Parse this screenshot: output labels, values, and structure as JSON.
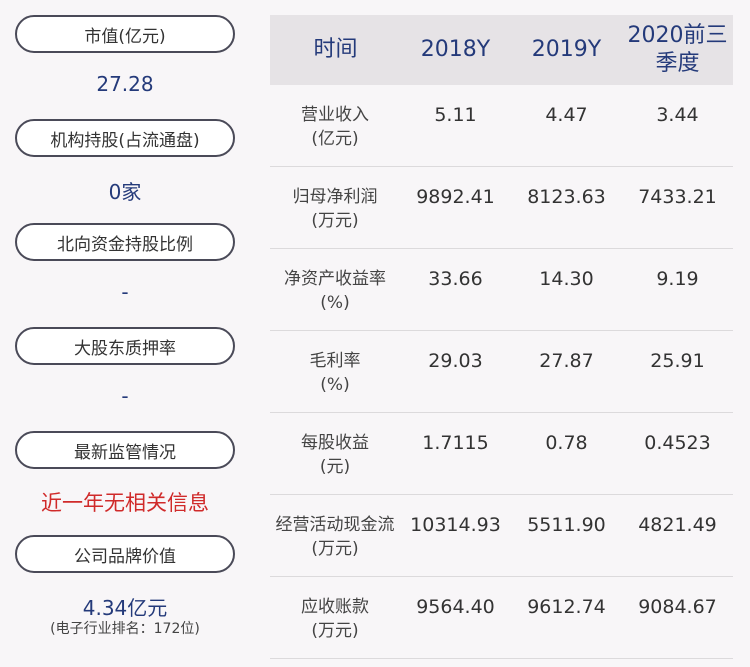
{
  "left": {
    "items": [
      {
        "label": "市值(亿元)",
        "value": "27.28"
      },
      {
        "label": "机构持股(占流通盘)",
        "value": "0家"
      },
      {
        "label": "北向资金持股比例",
        "value": "-"
      },
      {
        "label": "大股东质押率",
        "value": "-"
      },
      {
        "label": "最新监管情况",
        "value": "近一年无相关信息"
      },
      {
        "label": "公司品牌价值",
        "value": "4.34亿元",
        "sub": "(电子行业排名：172位)"
      }
    ]
  },
  "table": {
    "headers": [
      "时间",
      "2018Y",
      "2019Y",
      "2020前三季度"
    ],
    "rows": [
      {
        "label1": "营业收入",
        "label2": "(亿元)",
        "values": [
          "5.11",
          "4.47",
          "3.44"
        ]
      },
      {
        "label1": "归母净利润",
        "label2": "(万元)",
        "values": [
          "9892.41",
          "8123.63",
          "7433.21"
        ]
      },
      {
        "label1": "净资产收益率",
        "label2": "(%)",
        "values": [
          "33.66",
          "14.30",
          "9.19"
        ]
      },
      {
        "label1": "毛利率",
        "label2": "(%)",
        "values": [
          "29.03",
          "27.87",
          "25.91"
        ]
      },
      {
        "label1": "每股收益",
        "label2": "(元)",
        "values": [
          "1.7115",
          "0.78",
          "0.4523"
        ]
      },
      {
        "label1": "经营活动现金流",
        "label2": "(万元)",
        "values": [
          "10314.93",
          "5511.90",
          "4821.49"
        ]
      },
      {
        "label1": "应收账款",
        "label2": "(万元)",
        "values": [
          "9564.40",
          "9612.74",
          "9084.67"
        ]
      }
    ]
  }
}
